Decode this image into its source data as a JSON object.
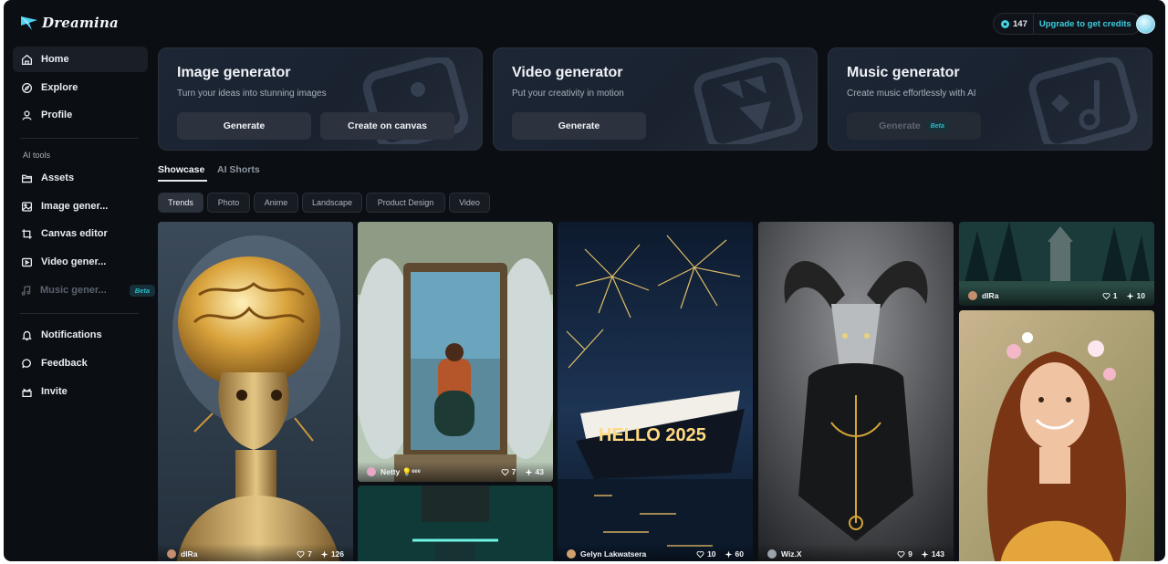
{
  "app": {
    "logo_text": "Dreamina"
  },
  "sidebar": {
    "items": [
      {
        "label": "Home",
        "icon": "home-icon",
        "active": true
      },
      {
        "label": "Explore",
        "icon": "compass-icon"
      },
      {
        "label": "Profile",
        "icon": "user-icon"
      }
    ],
    "tools_label": "AI tools",
    "tools": [
      {
        "label": "Assets",
        "icon": "folder-icon"
      },
      {
        "label": "Image gener...",
        "icon": "image-icon"
      },
      {
        "label": "Canvas editor",
        "icon": "crop-icon"
      },
      {
        "label": "Video gener...",
        "icon": "video-icon"
      },
      {
        "label": "Music gener...",
        "icon": "music-icon",
        "beta": "Beta",
        "disabled": true
      }
    ],
    "bottom": [
      {
        "label": "Notifications",
        "icon": "bell-icon"
      },
      {
        "label": "Feedback",
        "icon": "chat-icon"
      },
      {
        "label": "Invite",
        "icon": "gift-icon"
      }
    ]
  },
  "header": {
    "credits": "147",
    "upgrade": "Upgrade to get credits"
  },
  "cards": [
    {
      "title": "Image generator",
      "subtitle": "Turn your ideas into stunning images",
      "buttons": [
        "Generate",
        "Create on canvas"
      ]
    },
    {
      "title": "Video generator",
      "subtitle": "Put your creativity in motion",
      "buttons": [
        "Generate"
      ]
    },
    {
      "title": "Music generator",
      "subtitle": "Create music effortlessly with AI",
      "buttons": [
        "Generate"
      ],
      "beta": "Beta"
    }
  ],
  "tabs": [
    "Showcase",
    "AI Shorts"
  ],
  "filters": [
    "Trends",
    "Photo",
    "Anime",
    "Landscape",
    "Product Design",
    "Video"
  ],
  "gallery": [
    {
      "author": "dIRa",
      "likes": "7",
      "uses": "126"
    },
    {
      "author": "Netty 💡ᵉᵉᵉ",
      "likes": "7",
      "uses": "43"
    },
    {
      "author": "Gelyn Lakwatsera",
      "likes": "10",
      "uses": "60",
      "caption": "HELLO 2025"
    },
    {
      "author": "Wiz.X",
      "likes": "9",
      "uses": "143"
    },
    {
      "author": "dIRa",
      "likes": "1",
      "uses": "10"
    }
  ],
  "colors": {
    "accent": "#3ccfe0",
    "background": "#0b0e13",
    "card": "#1c2634"
  }
}
